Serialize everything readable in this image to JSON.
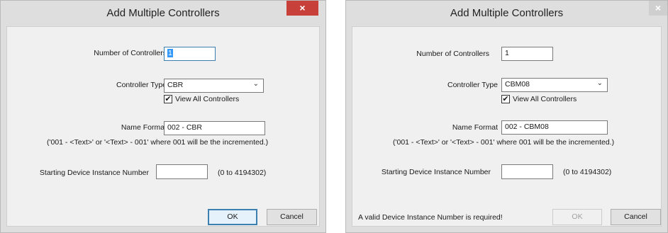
{
  "dialog1": {
    "title": "Add Multiple Controllers",
    "close_glyph": "×",
    "num_label": "Number of Controllers",
    "num_value": "1",
    "type_label": "Controller Type",
    "type_value": "CBR",
    "view_all_label": "View All Controllers",
    "view_all_checked": true,
    "name_label": "Name Format",
    "name_value": "002 - CBR",
    "hint": "('001 - <Text>' or '<Text> - 001' where 001 will be the incremented.)",
    "start_label": "Starting Device Instance Number",
    "start_value": "",
    "range": "(0 to 4194302)",
    "ok": "OK",
    "cancel": "Cancel"
  },
  "dialog2": {
    "title": "Add Multiple Controllers",
    "close_glyph": "×",
    "num_label": "Number of Controllers",
    "num_value": "1",
    "type_label": "Controller Type",
    "type_value": "CBM08",
    "view_all_label": "View All Controllers",
    "view_all_checked": true,
    "name_label": "Name Format",
    "name_value": "002 - CBM08",
    "hint": "('001 - <Text>' or '<Text> - 001' where 001 will be the incremented.)",
    "start_label": "Starting Device Instance Number",
    "start_value": "",
    "range": "(0 to 4194302)",
    "error": "A valid Device Instance Number is required!",
    "ok": "OK",
    "cancel": "Cancel"
  },
  "icons": {
    "check": "✔",
    "chevron": "⌄"
  },
  "colors": {
    "close_active": "#c7403a",
    "focus_border": "#3c7fb1",
    "selection": "#3399ff"
  }
}
